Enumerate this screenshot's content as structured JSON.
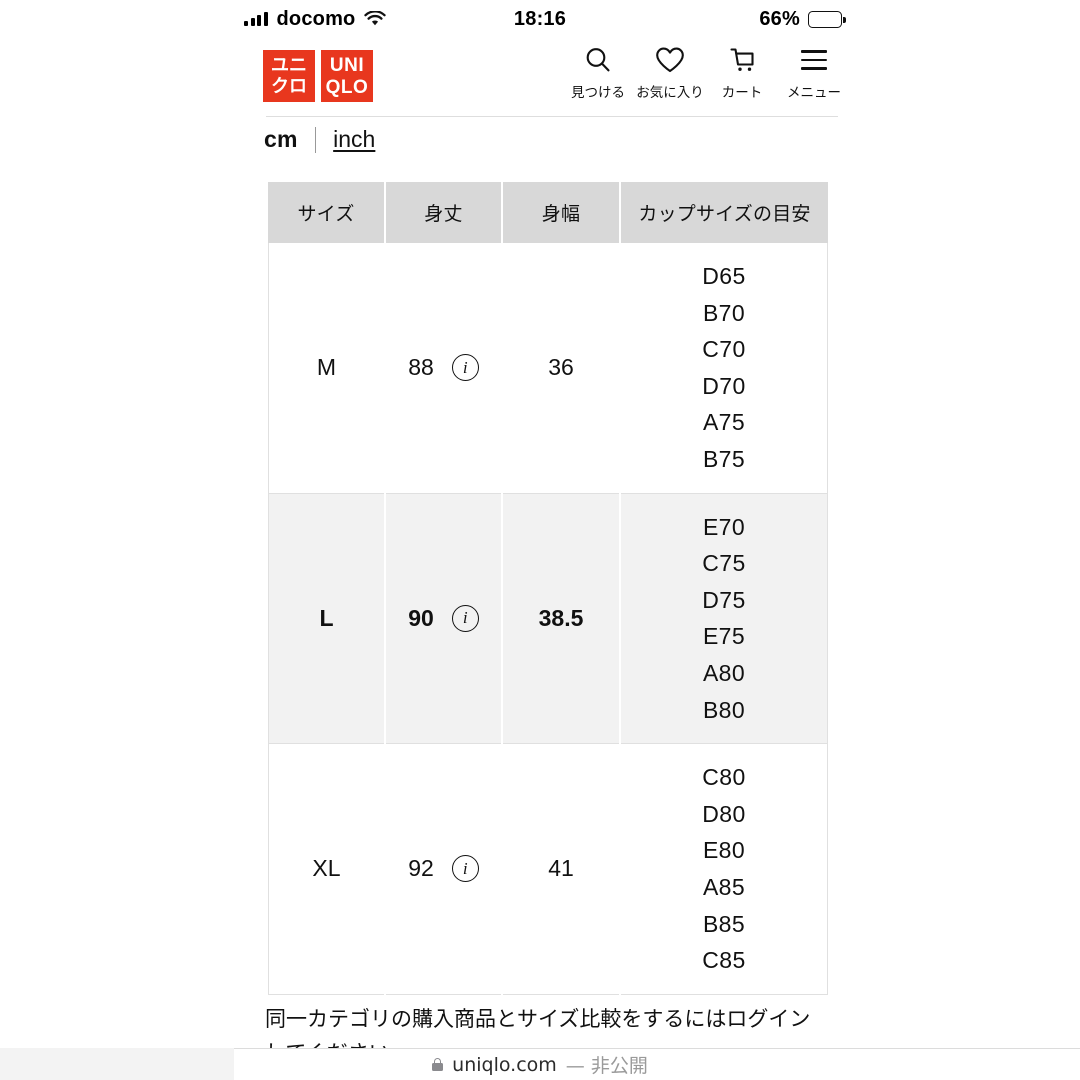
{
  "status_bar": {
    "carrier": "docomo",
    "time": "18:16",
    "battery_percent": "66%",
    "signal_icon": "cellular-signal-icon",
    "wifi_icon": "wifi-icon",
    "battery_icon": "battery-icon"
  },
  "header": {
    "logo": {
      "tile_jp_line1": "ユニ",
      "tile_jp_line2": "クロ",
      "tile_en_line1": "UNI",
      "tile_en_line2": "QLO",
      "color": "#e8371e"
    },
    "nav": [
      {
        "icon": "search-icon",
        "label": "見つける"
      },
      {
        "icon": "heart-icon",
        "label": "お気に入り"
      },
      {
        "icon": "cart-icon",
        "label": "カート"
      },
      {
        "icon": "menu-icon",
        "label": "メニュー"
      }
    ]
  },
  "units": {
    "cm_label": "cm",
    "separator": "|",
    "inch_label": "inch",
    "selected": "cm"
  },
  "table": {
    "columns": [
      "サイズ",
      "身丈",
      "身幅",
      "カップサイズの目安"
    ],
    "info_icon": "info-icon",
    "rows": [
      {
        "size": "M",
        "length": "88",
        "width": "36",
        "cups": [
          "D65",
          "B70",
          "C70",
          "D70",
          "A75",
          "B75"
        ],
        "highlighted": false
      },
      {
        "size": "L",
        "length": "90",
        "width": "38.5",
        "cups": [
          "E70",
          "C75",
          "D75",
          "E75",
          "A80",
          "B80"
        ],
        "highlighted": true
      },
      {
        "size": "XL",
        "length": "92",
        "width": "41",
        "cups": [
          "C80",
          "D80",
          "E80",
          "A85",
          "B85",
          "C85"
        ],
        "highlighted": false
      }
    ]
  },
  "footnote": {
    "text": "同一カテゴリの購入商品とサイズ比較をするにはログインしてください"
  },
  "safari_bar": {
    "lock_icon": "lock-icon",
    "domain": "uniqlo.com",
    "dash": "—",
    "private_label": "非公開"
  }
}
